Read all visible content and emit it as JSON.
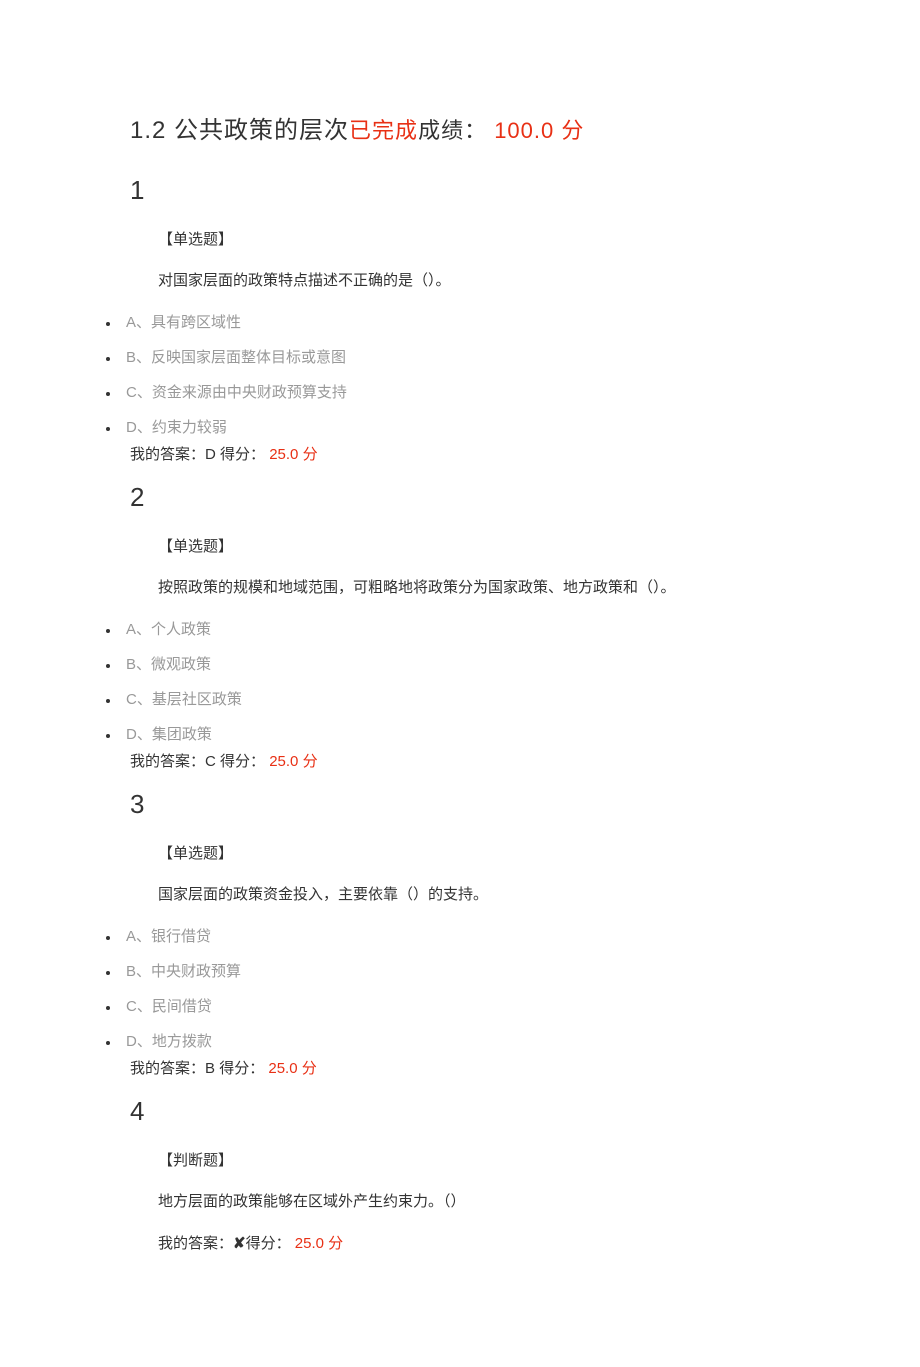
{
  "header": {
    "section_num": "1.2",
    "section_title": " 公共政策的层次",
    "status": "已完成",
    "score_label": "成绩：",
    "score_value": " 100.0",
    "score_unit": " 分"
  },
  "questions": [
    {
      "num": "1",
      "type": "【单选题】",
      "stem": "对国家层面的政策特点描述不正确的是（）。",
      "options": [
        {
          "letter": "A、",
          "text": "具有跨区域性"
        },
        {
          "letter": "B、",
          "text": "反映国家层面整体目标或意图"
        },
        {
          "letter": "C、",
          "text": "资金来源由中央财政预算支持"
        },
        {
          "letter": "D、",
          "text": "约束力较弱"
        }
      ],
      "answer_label": "我的答案：",
      "answer_value": "D",
      "points_label": " 得分：",
      "points_value": " 25.0",
      "points_unit": " 分"
    },
    {
      "num": "2",
      "type": "【单选题】",
      "stem": "按照政策的规模和地域范围，可粗略地将政策分为国家政策、地方政策和（）。",
      "options": [
        {
          "letter": "A、",
          "text": "个人政策"
        },
        {
          "letter": "B、",
          "text": "微观政策"
        },
        {
          "letter": "C、",
          "text": "基层社区政策"
        },
        {
          "letter": "D、",
          "text": "集团政策"
        }
      ],
      "answer_label": "我的答案：",
      "answer_value": "C",
      "points_label": " 得分：",
      "points_value": " 25.0",
      "points_unit": " 分"
    },
    {
      "num": "3",
      "type": "【单选题】",
      "stem": "国家层面的政策资金投入，主要依靠（）的支持。",
      "options": [
        {
          "letter": "A、",
          "text": "银行借贷"
        },
        {
          "letter": "B、",
          "text": "中央财政预算"
        },
        {
          "letter": "C、",
          "text": "民间借贷"
        },
        {
          "letter": "D、",
          "text": "地方拨款"
        }
      ],
      "answer_label": "我的答案：",
      "answer_value": "B",
      "points_label": " 得分：",
      "points_value": " 25.0",
      "points_unit": " 分"
    },
    {
      "num": "4",
      "type": "【判断题】",
      "stem": "地方层面的政策能够在区域外产生约束力。（）",
      "judge": true,
      "answer_label": "我的答案：",
      "answer_mark": "✘",
      "points_label": "得分：",
      "points_value": " 25.0",
      "points_unit": " 分"
    }
  ]
}
